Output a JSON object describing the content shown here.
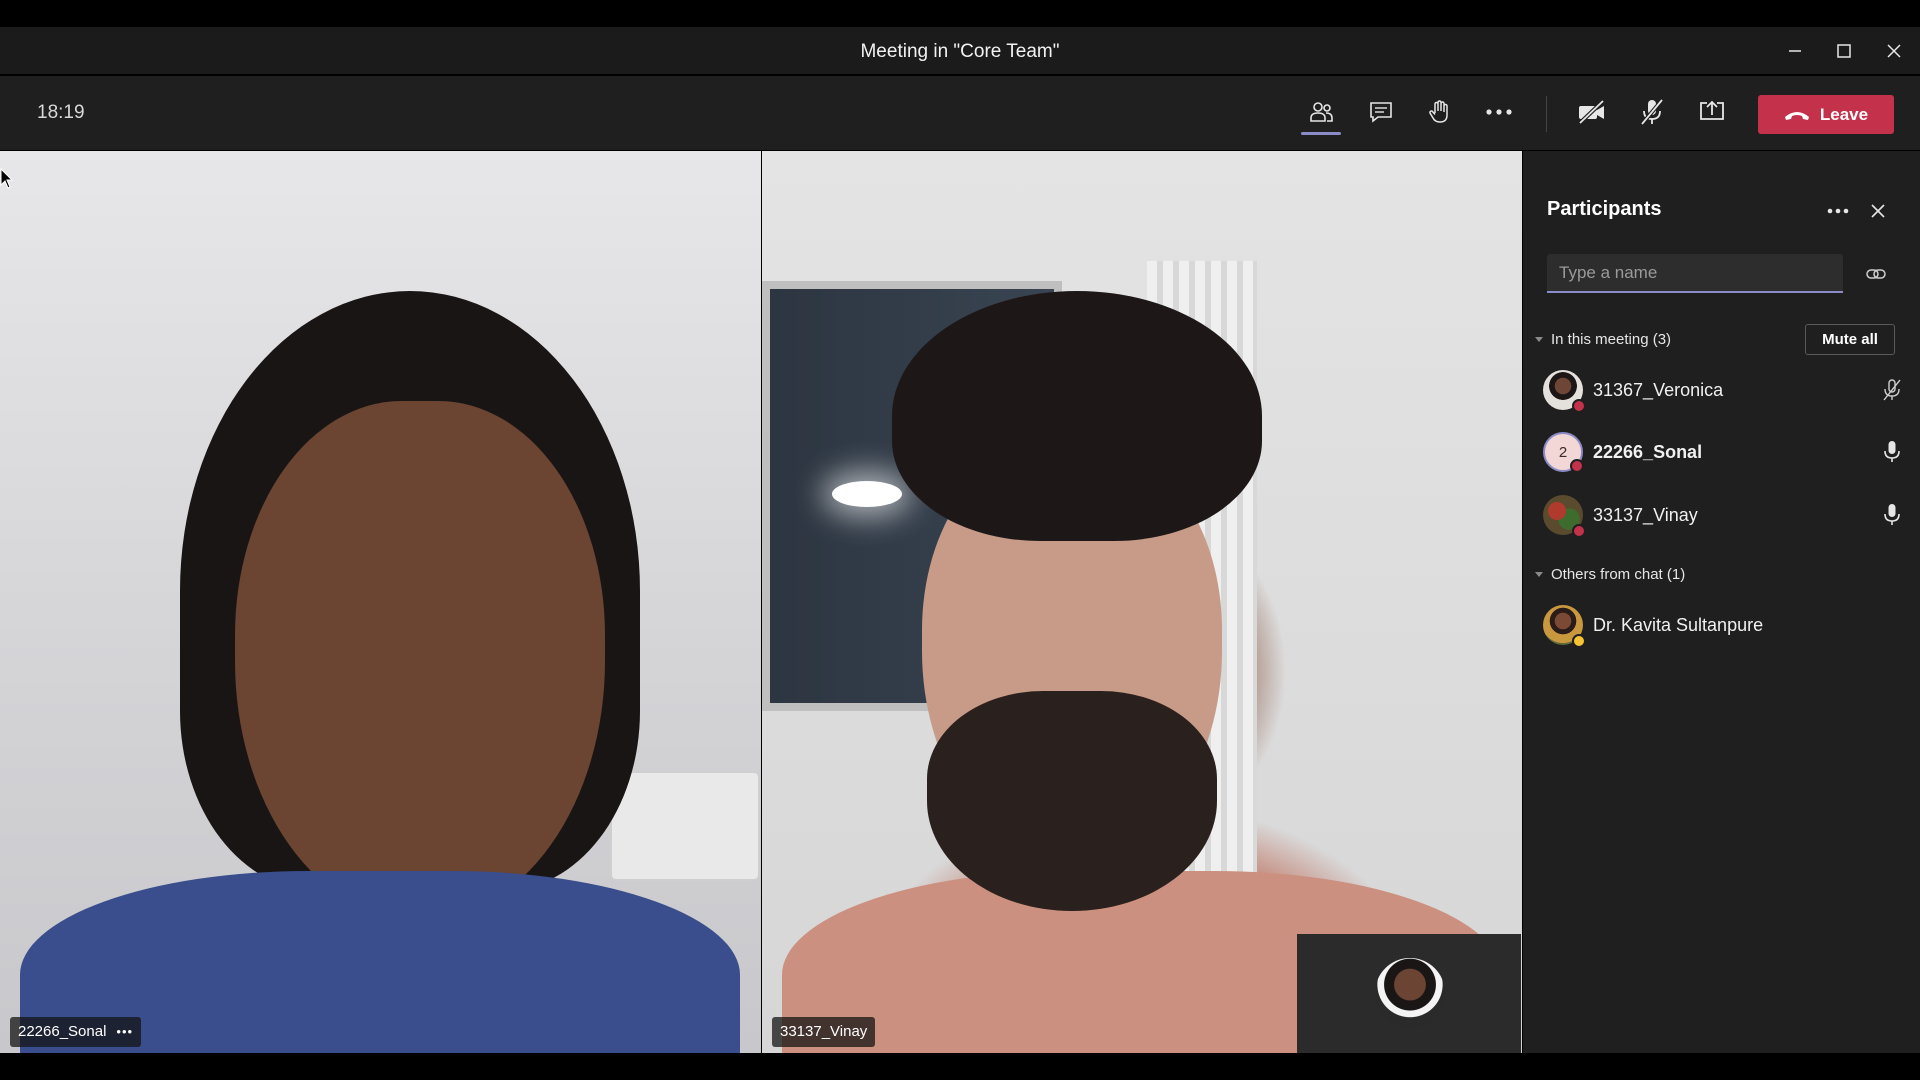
{
  "window": {
    "title": "Meeting in \"Core Team\"",
    "controls": [
      "minimize-icon",
      "maximize-icon",
      "close-icon"
    ]
  },
  "toolbar": {
    "time": "18:19",
    "buttons": [
      "participants-icon",
      "chat-icon",
      "raise-hand-icon",
      "more-options-icon",
      "camera-off-icon",
      "mic-off-icon",
      "share-screen-icon"
    ],
    "leave_label": "Leave",
    "leave_color": "#c4314b",
    "accent_color": "#8b8cc7"
  },
  "videos": [
    {
      "name": "22266_Sonal",
      "more": "•••"
    },
    {
      "name": "33137_Vinay"
    }
  ],
  "participants_panel": {
    "title": "Participants",
    "search_placeholder": "Type a name",
    "in_meeting_label": "In this meeting (3)",
    "mute_all_label": "Mute all",
    "in_meeting": [
      {
        "name": "31367_Veronica",
        "mic": "mic-off-icon",
        "presence": "busy"
      },
      {
        "name": "22266_Sonal",
        "initial": "2",
        "mic": "mic-icon",
        "presence": "busy"
      },
      {
        "name": "33137_Vinay",
        "mic": "mic-icon",
        "presence": "busy"
      }
    ],
    "others_label": "Others from chat (1)",
    "others": [
      {
        "name": "Dr. Kavita Sultanpure",
        "presence": "away"
      }
    ]
  }
}
